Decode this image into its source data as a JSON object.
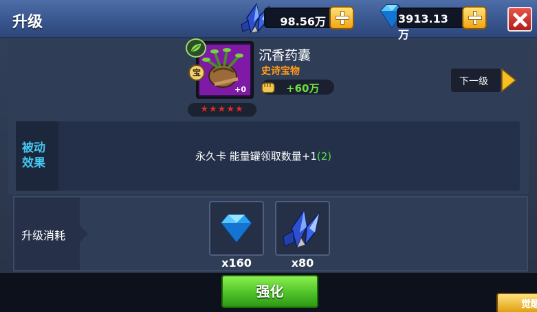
{
  "header": {
    "title": "升级",
    "crystal_amount": "98.56万",
    "gem_amount": "3913.13万"
  },
  "item": {
    "name": "沉香药囊",
    "quality": "史诗宝物",
    "quality_color": "#ff9a1a",
    "level_badge": "+0",
    "treasure_tag": "宝",
    "stars": 5,
    "stars_text": "★★★★★",
    "power_bonus": "+60万"
  },
  "next_level": {
    "label": "下一级"
  },
  "effect": {
    "label": "被动效果",
    "text": "永久卡 能量罐领取数量+1",
    "bonus": "(2)"
  },
  "cost": {
    "label": "升级消耗",
    "items": [
      {
        "icon": "blue-gem-icon",
        "count": "x160"
      },
      {
        "icon": "blue-crystal-icon",
        "count": "x80"
      }
    ]
  },
  "actions": {
    "enhance_label": "强化",
    "corner_label": "觉醒"
  },
  "colors": {
    "header_blue": "#3c5a94",
    "panel": "#2f3d57",
    "accent_cyan": "#44c8f0",
    "bonus_green": "#55e040",
    "button_green": "#4fc228",
    "close_red": "#c22a22"
  }
}
